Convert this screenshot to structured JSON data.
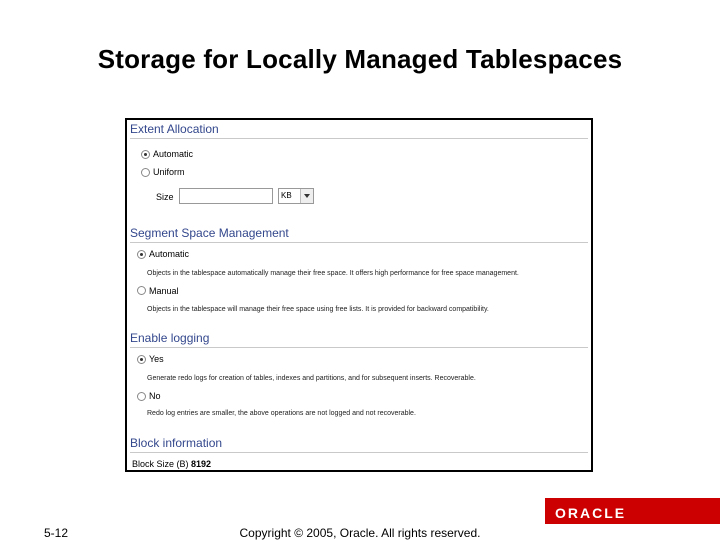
{
  "slide": {
    "title": "Storage for Locally Managed Tablespaces",
    "page_number": "5-12",
    "copyright": "Copyright © 2005, Oracle.  All rights reserved.",
    "logo_text": "ORACLE"
  },
  "extent_allocation": {
    "header": "Extent Allocation",
    "options": [
      "Automatic",
      "Uniform"
    ],
    "selected": "Automatic",
    "size_label": "Size",
    "size_value": "",
    "unit_value": "KB"
  },
  "segment_space": {
    "header": "Segment Space Management",
    "automatic_label": "Automatic",
    "automatic_desc": "Objects in the tablespace automatically manage their free space. It offers high performance for free space management.",
    "manual_label": "Manual",
    "manual_desc": "Objects in the tablespace will manage their free space using free lists. It is provided for backward compatibility.",
    "selected": "Automatic"
  },
  "logging": {
    "header": "Enable logging",
    "yes_label": "Yes",
    "yes_desc": "Generate redo logs for creation of tables, indexes and partitions, and for subsequent inserts. Recoverable.",
    "no_label": "No",
    "no_desc": "Redo log entries are smaller, the above operations are not logged and not recoverable.",
    "selected": "Yes"
  },
  "block_info": {
    "header": "Block information",
    "label": "Block Size (B)",
    "value": "8192"
  },
  "colors": {
    "section_header": "#33478c",
    "footer_red": "#cc0000"
  }
}
